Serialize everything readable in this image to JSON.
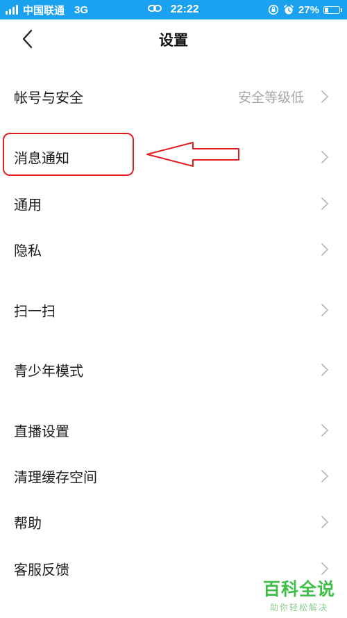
{
  "status_bar": {
    "carrier": "中国联通",
    "network": "3G",
    "time": "22:22",
    "battery": "27%",
    "battery_level": 0.27,
    "icons": [
      "signal-icon",
      "link-icon",
      "orientation-lock-icon",
      "alarm-icon",
      "battery-icon"
    ]
  },
  "nav": {
    "title": "设置",
    "back_icon": "chevron-left-icon"
  },
  "settings": {
    "items": [
      {
        "label": "帐号与安全",
        "value": "安全等级低"
      },
      {
        "label": "消息通知"
      },
      {
        "label": "通用"
      },
      {
        "label": "隐私"
      },
      {
        "label": "扫一扫"
      },
      {
        "label": "青少年模式"
      },
      {
        "label": "直播设置"
      },
      {
        "label": "清理缓存空间"
      },
      {
        "label": "帮助"
      },
      {
        "label": "客服反馈"
      }
    ],
    "chevron_icon": "chevron-right-icon"
  },
  "annotation": {
    "color": "#e02020",
    "highlighted_item": "消息通知"
  },
  "watermark": {
    "title": "百科全说",
    "subtitle": "助你轻松解决"
  },
  "colors": {
    "status_bar": "#1aa1f0",
    "secondary_text": "#a7a7a7",
    "chevron": "#b8b8b8",
    "watermark": "#3fbf4a"
  }
}
